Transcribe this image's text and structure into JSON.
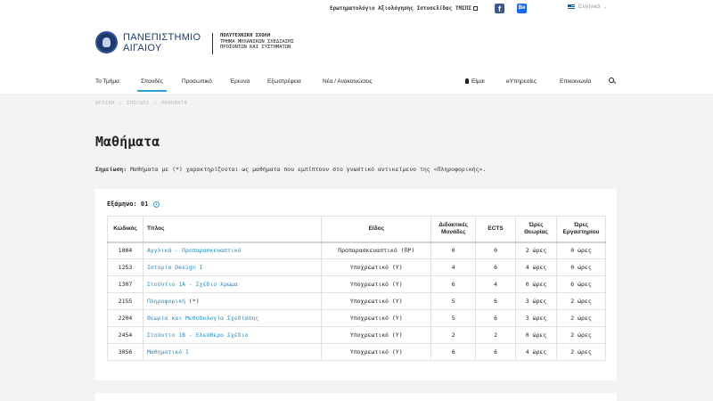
{
  "topbar": {
    "survey_link": "Ερωτηματολόγιο Αξιολόγησης Ιστοσελίδας ΤΜΣΠΣ",
    "facebook_glyph": "f",
    "behance_glyph": "Be",
    "language": "Ελληνικά",
    "language_caret": "⌄"
  },
  "logo": {
    "university_line1": "ΠΑΝΕΠΙΣΤΗΜΙΟ",
    "university_line2": "ΑΙΓΑΙΟΥ",
    "school_line1": "ΠΟΛΥΤΕΧΝΙΚΗ ΣΧΟΛΗ",
    "school_line2": "ΤΜΗΜΑ ΜΗΧΑΝΙΚΩΝ ΣΧΕΔΙΑΣΗΣ",
    "school_line3": "ΠΡΟΪΟΝΤΩΝ ΚΑΙ ΣΥΣΤΗΜΑΤΩΝ"
  },
  "nav": {
    "items": [
      {
        "label": "Το Τμήμα"
      },
      {
        "label": "Σπουδές"
      },
      {
        "label": "Προσωπικό"
      },
      {
        "label": "Έρευνα"
      },
      {
        "label": "Εξωστρέφεια"
      },
      {
        "label": "Νέα / Ανακοινώσεις"
      }
    ],
    "right_items": [
      {
        "label": "Είμαι"
      },
      {
        "label": "eΥπηρεσίες"
      },
      {
        "label": "Επικοινωνία"
      }
    ]
  },
  "breadcrumb": {
    "items": [
      "ΑΡΧΙΚΗ",
      "ΣΠΟΥΔΕΣ",
      "ΜΑΘΗΜΑΤΑ"
    ],
    "separator": "/"
  },
  "page": {
    "title": "Μαθήματα",
    "note_label": "Σημείωση:",
    "note_text": " Μαθήματα με (*) χαρακτηρίζονται ως μαθήματα που εμπίπτουν στο γνωστικό αντικείμενο της «Πληροφορικής»."
  },
  "semester": {
    "label": "Εξάμηνο: 01"
  },
  "table": {
    "headers": {
      "code": "Κωδικός",
      "title": "Τίτλος",
      "type": "Είδος",
      "units_1": "Διδακτικές",
      "units_2": "Μονάδες",
      "ects": "ECTS",
      "theory_1": "Ώρες",
      "theory_2": "Θεωρίας",
      "lab_1": "Ώρες",
      "lab_2": "Εργαστηρίου"
    },
    "rows": [
      {
        "code": "1004",
        "title": "Αγγλικά - Προπαρασκευαστικό",
        "suffix": "",
        "type": "Προπαρασκευαστικό (ΠΡ)",
        "units": "0",
        "ects": "0",
        "theory": "2 ώρες",
        "lab": "0 ώρες"
      },
      {
        "code": "1253",
        "title": "Ιστορία Design I",
        "suffix": "",
        "type": "Υποχρεωτικό (Υ)",
        "units": "4",
        "ects": "6",
        "theory": "4 ώρες",
        "lab": "0 ώρες"
      },
      {
        "code": "1307",
        "title": "Στούντιο 1Α - Σχέδιο Χρώμα",
        "suffix": "",
        "type": "Υποχρεωτικό (Υ)",
        "units": "6",
        "ects": "4",
        "theory": "0 ώρες",
        "lab": "6 ώρες"
      },
      {
        "code": "2155",
        "title": "Πληροφορική",
        "suffix": " (*)",
        "type": "Υποχρεωτικό (Υ)",
        "units": "5",
        "ects": "6",
        "theory": "3 ώρες",
        "lab": "2 ώρες"
      },
      {
        "code": "2204",
        "title": "Θεωρία και Μεθοδολογία Σχεδίασης",
        "suffix": "",
        "type": "Υποχρεωτικό (Υ)",
        "units": "5",
        "ects": "6",
        "theory": "3 ώρες",
        "lab": "2 ώρες"
      },
      {
        "code": "2454",
        "title": "Στούντιο 1Β - Ελεύθερο Σχέδιο",
        "suffix": "",
        "type": "Υποχρεωτικό (Υ)",
        "units": "2",
        "ects": "2",
        "theory": "0 ώρες",
        "lab": "2 ώρες"
      },
      {
        "code": "3056",
        "title": "Μαθηματικό Ι",
        "suffix": "",
        "type": "Υποχρεωτικό (Υ)",
        "units": "6",
        "ects": "6",
        "theory": "4 ώρες",
        "lab": "2 ώρες"
      }
    ]
  },
  "colors": {
    "accent": "#2ea0d5",
    "link": "#2b8fc4",
    "facebook": "#3b5998",
    "behance": "#1769ff"
  }
}
